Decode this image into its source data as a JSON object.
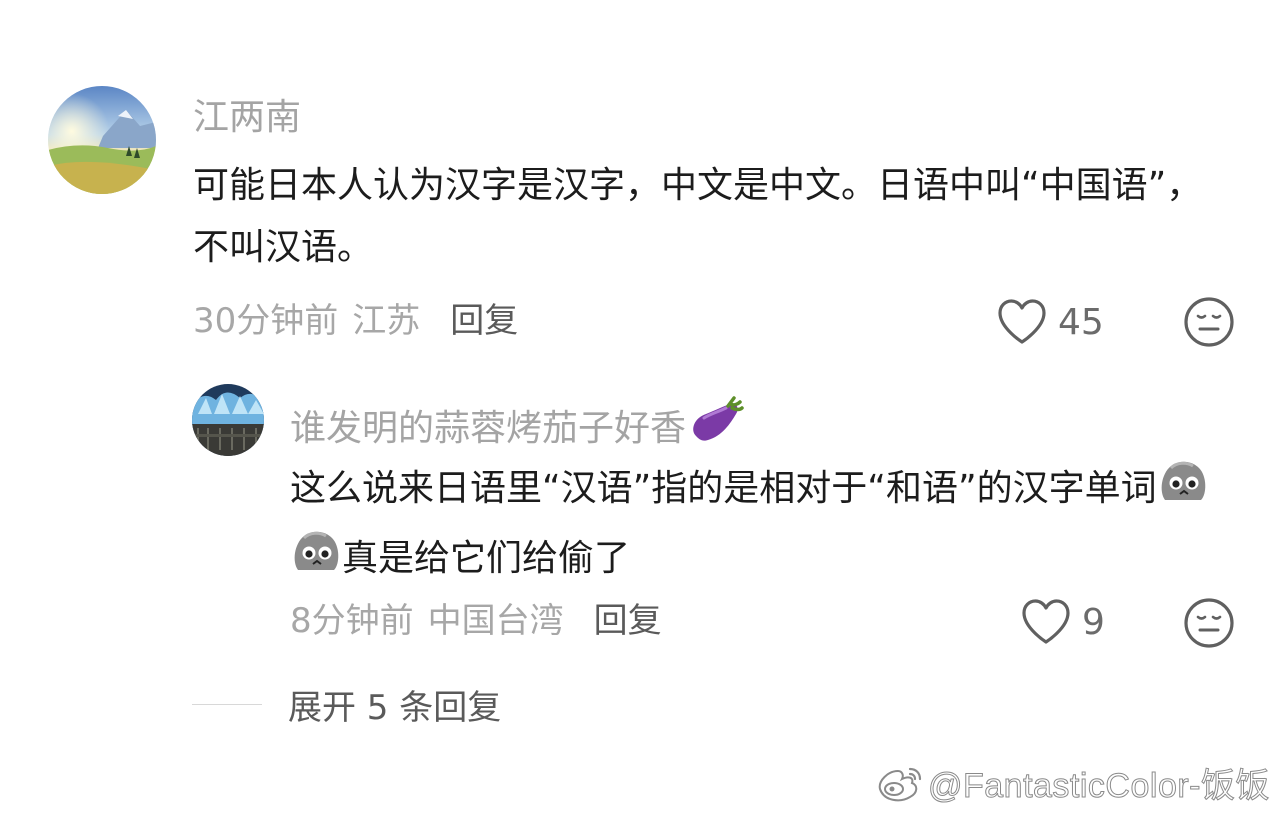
{
  "comments": [
    {
      "username": "江两南",
      "text": "可能日本人认为汉字是汉字，中文是中文。日语中叫“中国语”，不叫汉语。",
      "time": "30分钟前",
      "location": "江苏",
      "reply_label": "回复",
      "like_count": "45",
      "like_icon": "heart-outline-icon",
      "dislike_icon": "meh-face-icon"
    }
  ],
  "replies": [
    {
      "username": "谁发明的蒜蓉烤茄子好香",
      "username_emoji": "eggplant-emoji",
      "text_before": "这么说来日语里“汉语”指的是相对于“和语”的汉字单词",
      "text_emojis": [
        "pleading-rock-emoji",
        "pleading-rock-emoji"
      ],
      "text_after": "真是给它们给偷了",
      "time": "8分钟前",
      "location": "中国台湾",
      "reply_label": "回复",
      "like_count": "9",
      "like_icon": "heart-outline-icon",
      "dislike_icon": "meh-face-icon"
    }
  ],
  "expand": {
    "label": "展开 5 条回复"
  },
  "watermark": {
    "logo": "weibo-logo",
    "text": "@FantasticColor-饭饭"
  },
  "colors": {
    "secondary_text": "#a4a4a4",
    "primary_text": "#1c1c1c",
    "action_text": "#5a5a5a",
    "icon_stroke": "#606060"
  }
}
